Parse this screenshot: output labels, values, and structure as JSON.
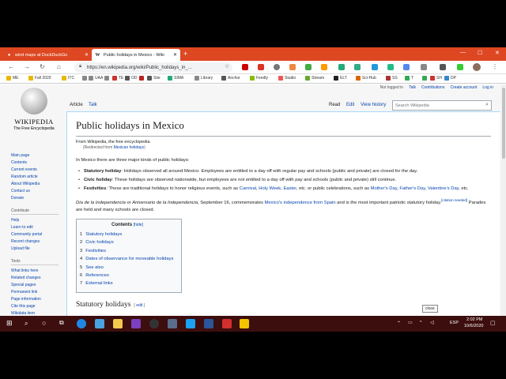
{
  "browser": {
    "tabs": [
      {
        "title": "wind maps at DuckDuckGo"
      },
      {
        "title": "Public holidays in Mexico - Wiki",
        "active": true
      }
    ],
    "url": "https://en.wikipedia.org/wiki/Public_holidays_in_...",
    "bookmarks": [
      "ME",
      "Fall 2020",
      "ITC",
      "UAA",
      "TE",
      "OD",
      "Site",
      "SIMA",
      "Library",
      "Anchor",
      "Feedly",
      "Studio",
      "Stream",
      "ELT",
      "Sci-Hub",
      "SS",
      "T",
      "SH",
      "DP"
    ],
    "accent": "#dd4822"
  },
  "wiki": {
    "logo_wordmark": "Wikipedia",
    "logo_tagline": "The Free Encyclopedia",
    "user_tools": [
      "Not logged in",
      "Talk",
      "Contributions",
      "Create account",
      "Log in"
    ],
    "tabs_left": [
      "Article",
      "Talk"
    ],
    "tabs_right": [
      "Read",
      "Edit",
      "View history"
    ],
    "search_placeholder": "Search Wikipedia",
    "sidebar": {
      "nav": [
        "Main page",
        "Contents",
        "Current events",
        "Random article",
        "About Wikipedia",
        "Contact us",
        "Donate"
      ],
      "contribute_heading": "Contribute",
      "contribute": [
        "Help",
        "Learn to edit",
        "Community portal",
        "Recent changes",
        "Upload file"
      ],
      "tools_heading": "Tools",
      "tools": [
        "What links here",
        "Related changes",
        "Special pages",
        "Permanent link",
        "Page information",
        "Cite this page",
        "Wikidata item"
      ]
    },
    "article": {
      "title": "Public holidays in Mexico",
      "from": "From Wikipedia, the free encyclopedia",
      "redirect_prefix": "(Redirected from ",
      "redirect_link": "Mexican holidays",
      "redirect_suffix": ")",
      "intro": "In Mexico there are three major kinds of public holidays:",
      "bullets": [
        {
          "term": "Statutory holiday",
          "text": ": Holidays observed all around Mexico. Employees are entitled to a day off with regular pay and schools (public and private) are closed for the day."
        },
        {
          "term": "Civic holiday",
          "text": ": These holidays are observed nationwide, but employees are not entitled to a day off with pay and schools (public and private) still continue."
        },
        {
          "term": "Festivities",
          "text_a": ": These are traditional holidays to honor religious events, such as ",
          "link1": "Carnival",
          "sep1": ", ",
          "link2": "Holy Week",
          "sep2": ", ",
          "link3": "Easter",
          "text_b": ", etc. or public celebrations, such as ",
          "link4": "Mother's Day",
          "sep3": ", ",
          "link5": "Father's Day",
          "sep4": ", ",
          "link6": "Valentine's Day",
          "text_c": ", etc."
        }
      ],
      "para2_italic": "Día de la Independencia",
      "para2_a": " or ",
      "para2_italic2": "Aniversario de la Independencia",
      "para2_b": ", September 16, commemorates ",
      "para2_link": "Mexico's independence from Spain",
      "para2_c": " and is the most important patriotic statutory holiday.",
      "citation": "[citation needed]",
      "para2_d": " Parades are held and many schools are closed.",
      "toc_title": "Contents",
      "toc_hide": "[hide]",
      "toc": [
        {
          "n": "1",
          "t": "Statutory holidays"
        },
        {
          "n": "2",
          "t": "Civic holidays"
        },
        {
          "n": "3",
          "t": "Festivities"
        },
        {
          "n": "4",
          "t": "Dates of observance for moveable holidays"
        },
        {
          "n": "5",
          "t": "See also"
        },
        {
          "n": "6",
          "t": "References"
        },
        {
          "n": "7",
          "t": "External links"
        }
      ],
      "section_heading": "Statutory holidays",
      "edit_link": "edit"
    },
    "tooltip": "close"
  },
  "taskbar": {
    "lang": "ESP",
    "time": "2:02 PM",
    "date": "10/6/2020"
  }
}
